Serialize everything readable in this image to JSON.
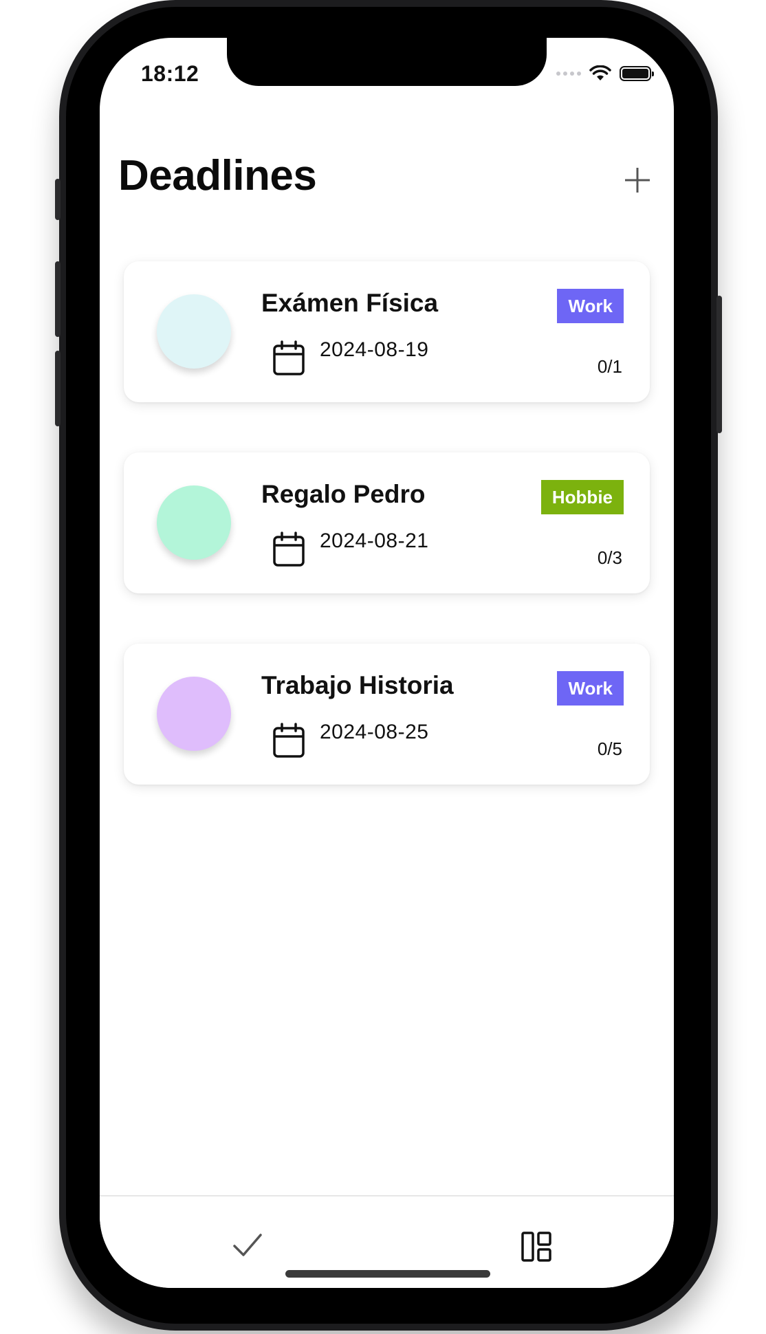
{
  "status_bar": {
    "time": "18:12",
    "wifi_icon": "wifi-icon",
    "battery_icon": "battery-icon"
  },
  "header": {
    "title": "Deadlines",
    "add_icon": "plus-icon"
  },
  "deadlines": [
    {
      "title": "Exámen Física",
      "date": "2024-08-19",
      "tag": "Work",
      "tag_color": "#6e66f5",
      "progress": "0/1",
      "circle_color": "#dff5f7"
    },
    {
      "title": "Regalo Pedro",
      "date": "2024-08-21",
      "tag": "Hobbie",
      "tag_color": "#7cb20e",
      "progress": "0/3",
      "circle_color": "#b3f5d9"
    },
    {
      "title": "Trabajo Historia",
      "date": "2024-08-25",
      "tag": "Work",
      "tag_color": "#6e66f5",
      "progress": "0/5",
      "circle_color": "#dfbdfc"
    }
  ],
  "tabbar": {
    "tabs": [
      {
        "icon": "checkmark-icon"
      },
      {
        "icon": "board-layout-icon"
      }
    ]
  }
}
